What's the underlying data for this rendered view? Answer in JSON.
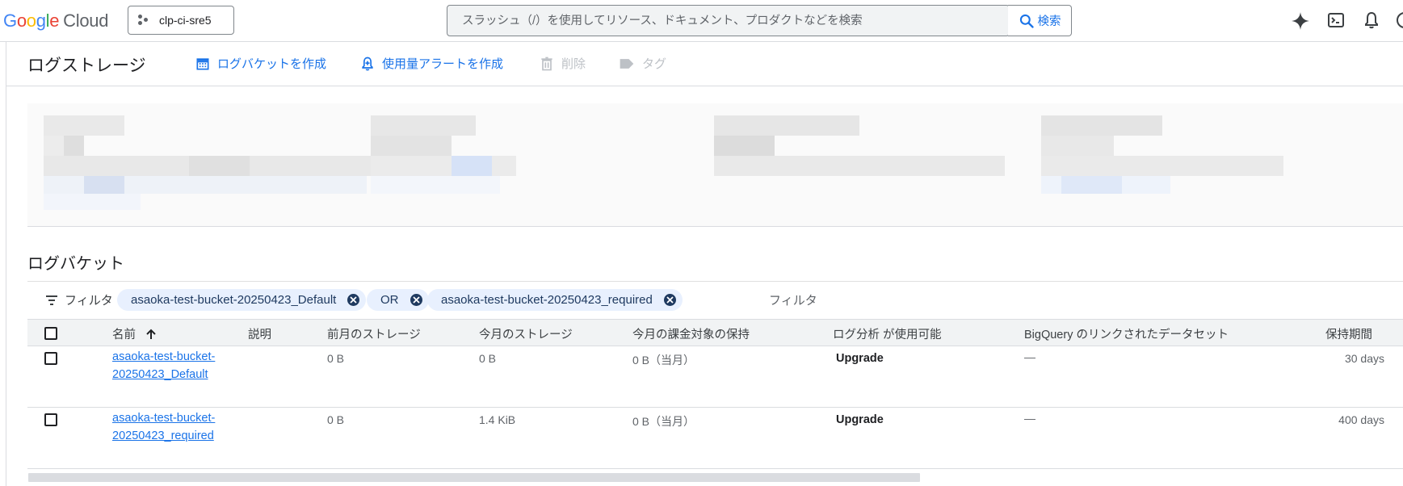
{
  "header": {
    "logo_g": [
      "G",
      "o",
      "o",
      "g",
      "l",
      "e"
    ],
    "logo_cloud": "Cloud",
    "project_name": "clp-ci-sre5",
    "search_placeholder": "スラッシュ（/）を使用してリソース、ドキュメント、プロダクトなどを検索",
    "search_button": "検索",
    "icons": [
      "gemini-icon",
      "cloud-shell-icon",
      "notifications-icon",
      "help-icon"
    ]
  },
  "toolbar": {
    "title": "ログストレージ",
    "create_bucket": "ログバケットを作成",
    "usage_alert": "使用量アラートを作成",
    "delete": "削除",
    "tag": "タグ"
  },
  "buckets_section": {
    "title": "ログバケット",
    "filter_label": "フィルタ",
    "chips": [
      "asaoka-test-bucket-20250423_Default",
      "OR",
      "asaoka-test-bucket-20250423_required"
    ],
    "filter_placeholder": "フィルタ"
  },
  "table": {
    "columns": {
      "name": "名前",
      "description": "説明",
      "prev_storage": "前月のストレージ",
      "cur_storage": "今月のストレージ",
      "billable": "今月の課金対象の保持",
      "log_analytics": "ログ分析 が使用可能",
      "bigquery": "BigQuery のリンクされたデータセット",
      "retention": "保持期間"
    },
    "rows": [
      {
        "name": "asaoka-test-bucket-20250423_Default",
        "description": "",
        "prev_storage": "0 B",
        "cur_storage": "0 B",
        "billable": "0 B（当月）",
        "log_analytics": "Upgrade",
        "bigquery": "—",
        "retention": "30 days"
      },
      {
        "name": "asaoka-test-bucket-20250423_required",
        "description": "",
        "prev_storage": "0 B",
        "cur_storage": "1.4 KiB",
        "billable": "0 B（当月）",
        "log_analytics": "Upgrade",
        "bigquery": "—",
        "retention": "400 days"
      }
    ]
  },
  "colors": {
    "accent": "#1a73e8",
    "chip_bg": "#e8f0fe",
    "header_bg": "#f1f3f4",
    "border": "#dadce0"
  }
}
